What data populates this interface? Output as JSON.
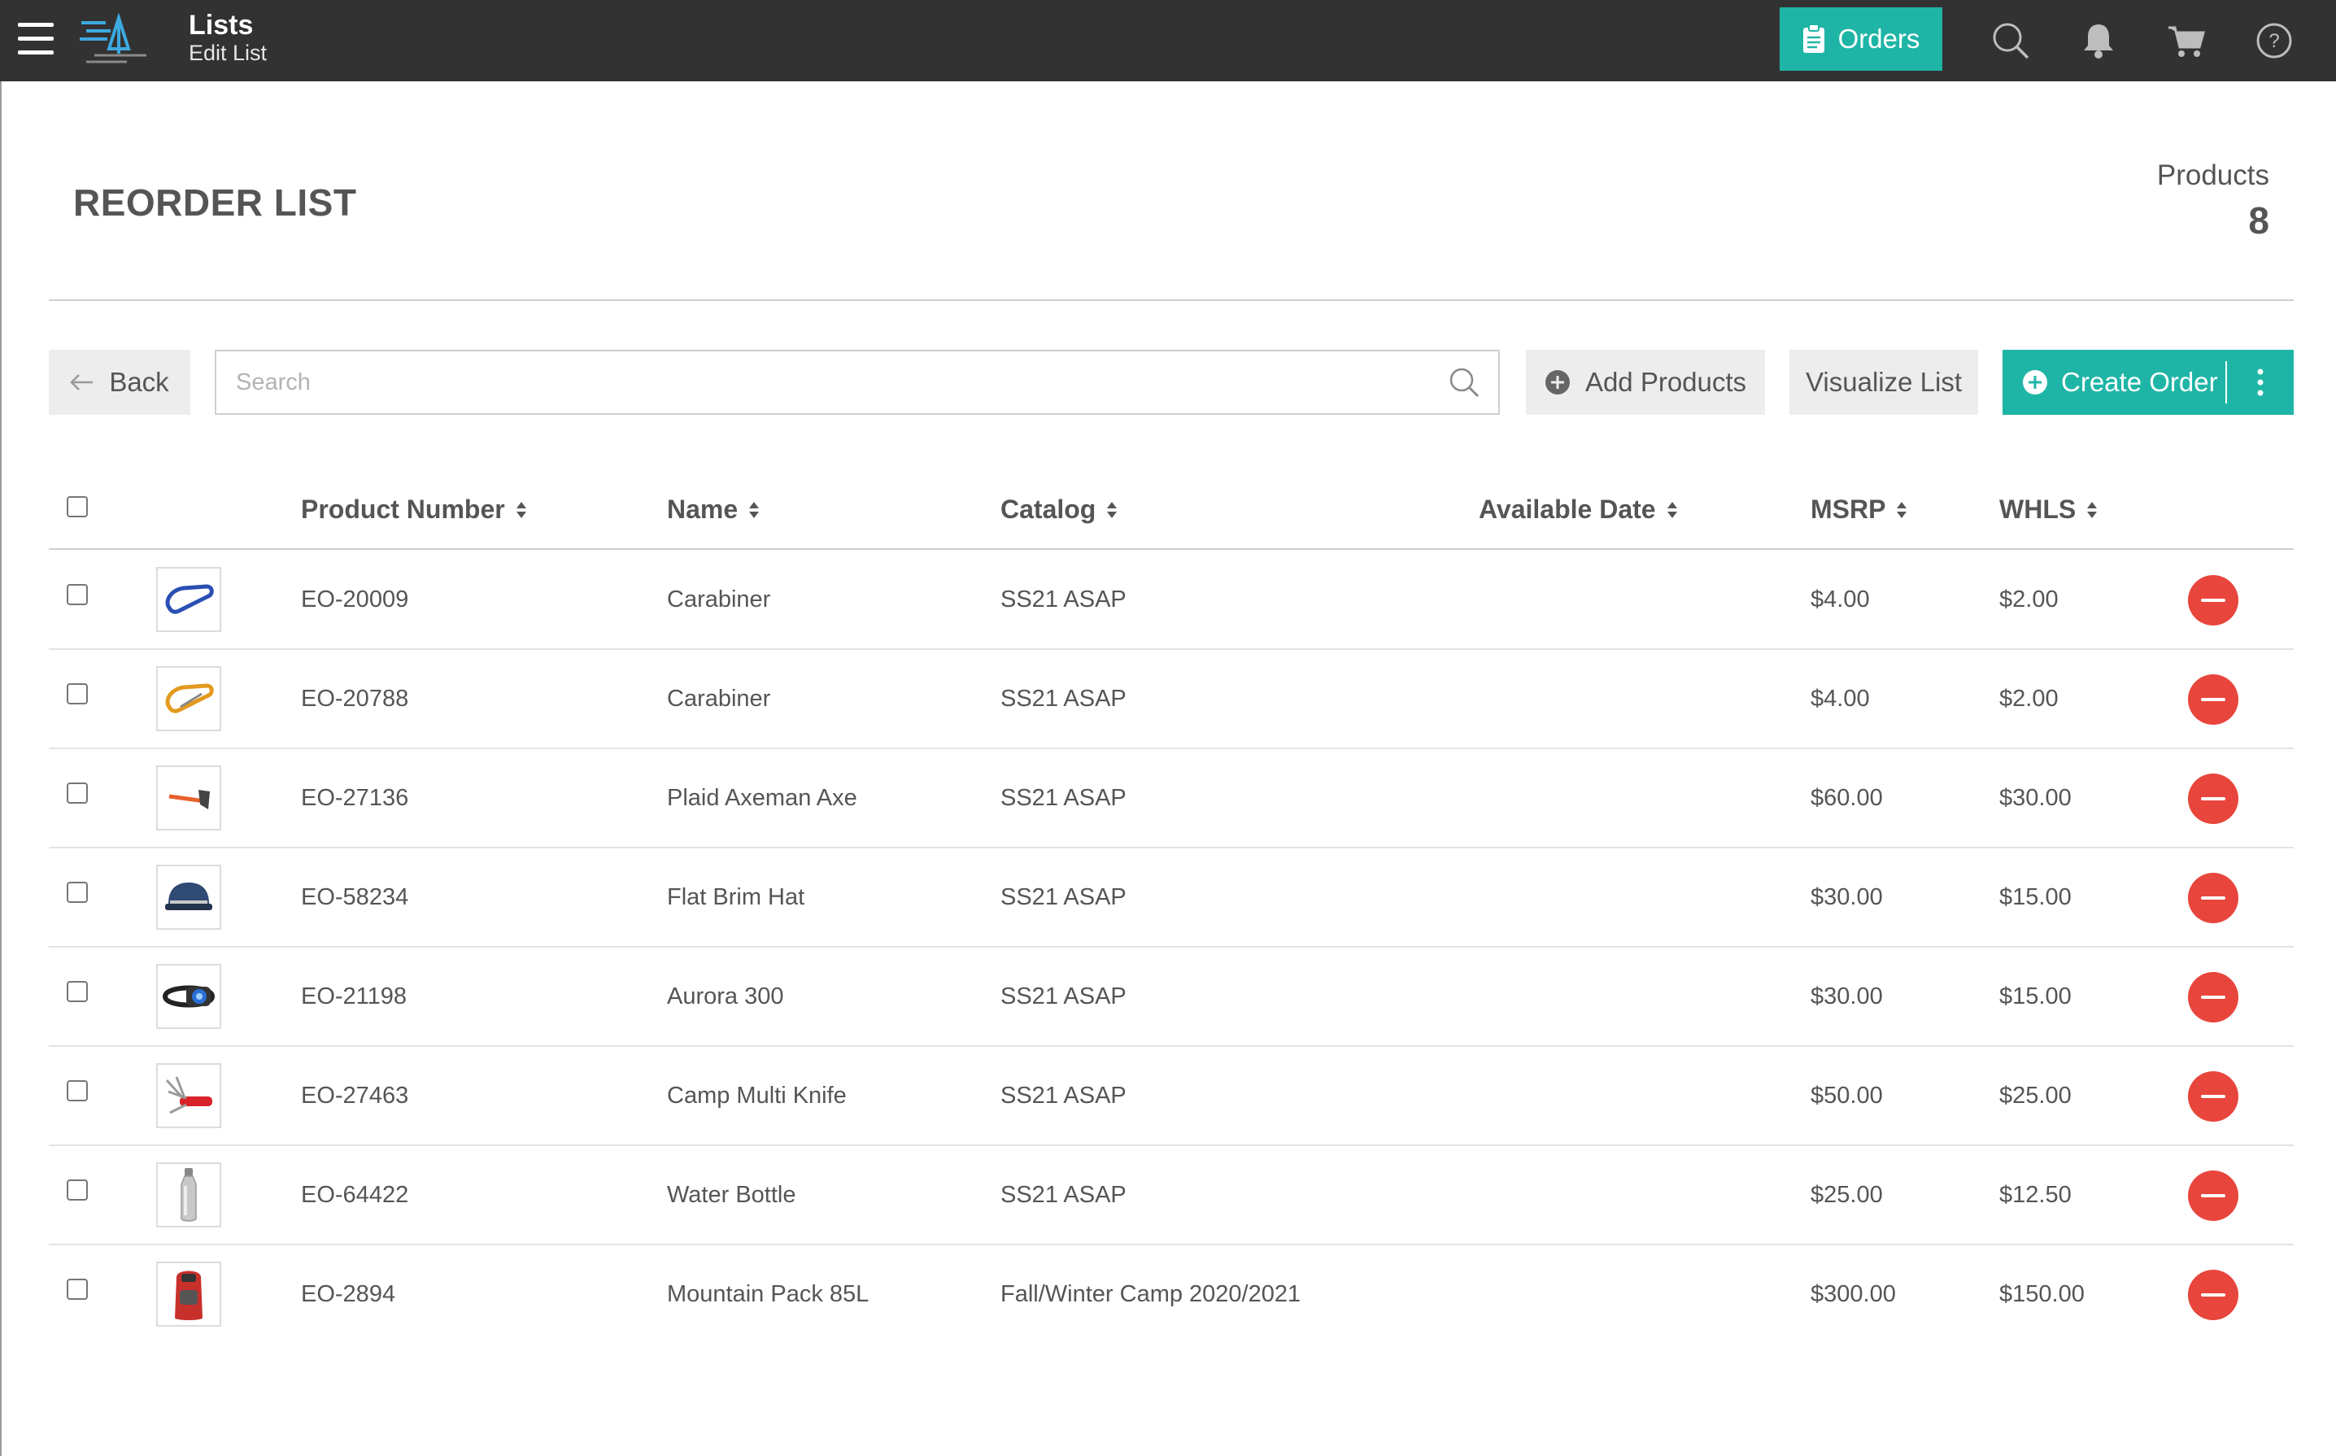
{
  "app": {
    "title": "Lists",
    "subtitle": "Edit List"
  },
  "topbar": {
    "orders_label": "Orders",
    "icons": [
      "search-icon",
      "bell-icon",
      "cart-icon",
      "help-icon"
    ]
  },
  "page": {
    "title": "REORDER LIST",
    "products_label": "Products",
    "products_count": "8"
  },
  "toolbar": {
    "back_label": "Back",
    "search_placeholder": "Search",
    "search_value": "",
    "add_products_label": "Add Products",
    "visualize_label": "Visualize List",
    "create_order_label": "Create Order"
  },
  "table": {
    "columns": [
      "Product Number",
      "Name",
      "Catalog",
      "Available Date",
      "MSRP",
      "WHLS"
    ],
    "rows": [
      {
        "number": "EO-20009",
        "name": "Carabiner",
        "catalog": "SS21 ASAP",
        "available": "",
        "msrp": "$4.00",
        "whls": "$2.00",
        "thumb": "carabiner-blue"
      },
      {
        "number": "EO-20788",
        "name": "Carabiner",
        "catalog": "SS21 ASAP",
        "available": "",
        "msrp": "$4.00",
        "whls": "$2.00",
        "thumb": "carabiner-orange"
      },
      {
        "number": "EO-27136",
        "name": "Plaid Axeman Axe",
        "catalog": "SS21 ASAP",
        "available": "",
        "msrp": "$60.00",
        "whls": "$30.00",
        "thumb": "axe"
      },
      {
        "number": "EO-58234",
        "name": "Flat Brim Hat",
        "catalog": "SS21 ASAP",
        "available": "",
        "msrp": "$30.00",
        "whls": "$15.00",
        "thumb": "hat"
      },
      {
        "number": "EO-21198",
        "name": "Aurora 300",
        "catalog": "SS21 ASAP",
        "available": "",
        "msrp": "$30.00",
        "whls": "$15.00",
        "thumb": "headlamp"
      },
      {
        "number": "EO-27463",
        "name": "Camp Multi Knife",
        "catalog": "SS21 ASAP",
        "available": "",
        "msrp": "$50.00",
        "whls": "$25.00",
        "thumb": "knife"
      },
      {
        "number": "EO-64422",
        "name": "Water Bottle",
        "catalog": "SS21 ASAP",
        "available": "",
        "msrp": "$25.00",
        "whls": "$12.50",
        "thumb": "bottle"
      },
      {
        "number": "EO-2894",
        "name": "Mountain Pack 85L",
        "catalog": "Fall/Winter Camp 2020/2021",
        "available": "",
        "msrp": "$300.00",
        "whls": "$150.00",
        "thumb": "backpack"
      }
    ]
  },
  "colors": {
    "topbar": "#323232",
    "accent": "#1fb5a6",
    "danger": "#e8453c",
    "button_grey": "#ededed"
  }
}
